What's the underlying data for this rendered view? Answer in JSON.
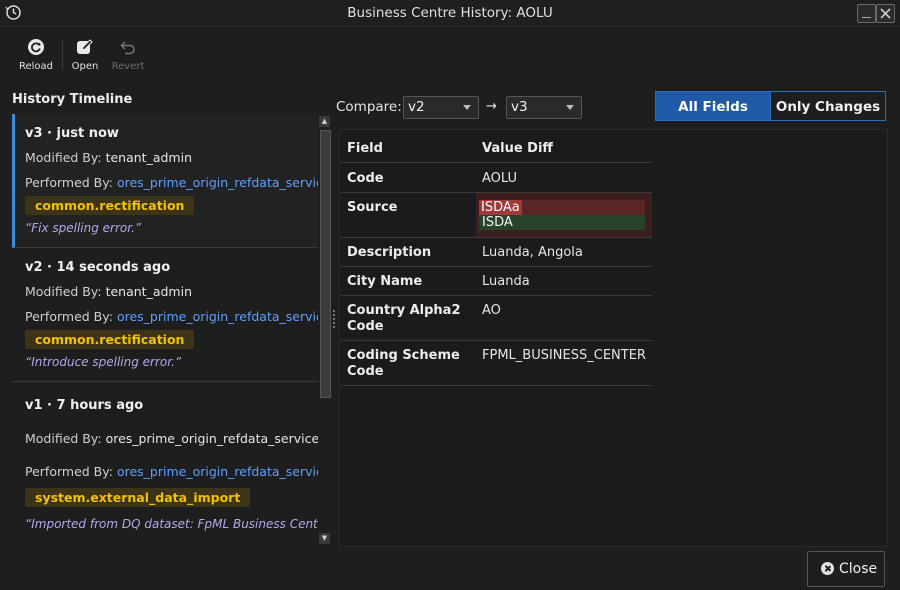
{
  "window": {
    "title": "Business Centre History: AOLU"
  },
  "toolbar": {
    "reload_label": "Reload",
    "open_label": "Open",
    "revert_label": "Revert"
  },
  "history": {
    "heading": "History Timeline",
    "modified_prefix": "Modified By:",
    "performed_prefix": "Performed By:",
    "entries": [
      {
        "version": "v3 · just now",
        "modified_by": "tenant_admin",
        "performed_by": "ores_prime_origin_refdata_service",
        "tag": "common.rectification",
        "note": "“Fix spelling error.”"
      },
      {
        "version": "v2 · 14 seconds ago",
        "modified_by": "tenant_admin",
        "performed_by": "ores_prime_origin_refdata_service",
        "tag": "common.rectification",
        "note": "“Introduce spelling error.”"
      },
      {
        "version": "v1 · 7 hours ago",
        "modified_by": "ores_prime_origin_refdata_service",
        "performed_by": "ores_prime_origin_refdata_service",
        "tag": "system.external_data_import",
        "note": "“Imported from DQ dataset: FpML Business Center”"
      }
    ]
  },
  "compare": {
    "label": "Compare:",
    "from": "v2",
    "arrow": "→",
    "to": "v3",
    "mode_all": "All Fields",
    "mode_changes": "Only Changes",
    "selected_mode": "All Fields"
  },
  "diff": {
    "col_field": "Field",
    "col_value": "Value Diff",
    "rows": [
      {
        "field": "Code",
        "value": "AOLU"
      },
      {
        "field": "Source",
        "old": "ISDAa",
        "new": "ISDA"
      },
      {
        "field": "Description",
        "value": "Luanda, Angola"
      },
      {
        "field": "City Name",
        "value": "Luanda"
      },
      {
        "field": "Country Alpha2\nCode",
        "value": "AO"
      },
      {
        "field": "Coding Scheme\nCode",
        "value": "FPML_BUSINESS_CENTER"
      }
    ]
  },
  "footer": {
    "close_label": "Close"
  },
  "colors": {
    "accent": "#1f5aa6",
    "link": "#5aa0ff",
    "badge_text": "#f2c200",
    "note_text": "#b7a7e8",
    "diff_removed": "#a03a3a",
    "diff_added": "#27432a"
  },
  "icons": [
    "history-icon",
    "minimize-icon",
    "close-icon",
    "reload-icon",
    "edit-icon",
    "undo-icon",
    "scroll-up-icon",
    "scroll-down-icon",
    "close-circle-icon"
  ]
}
